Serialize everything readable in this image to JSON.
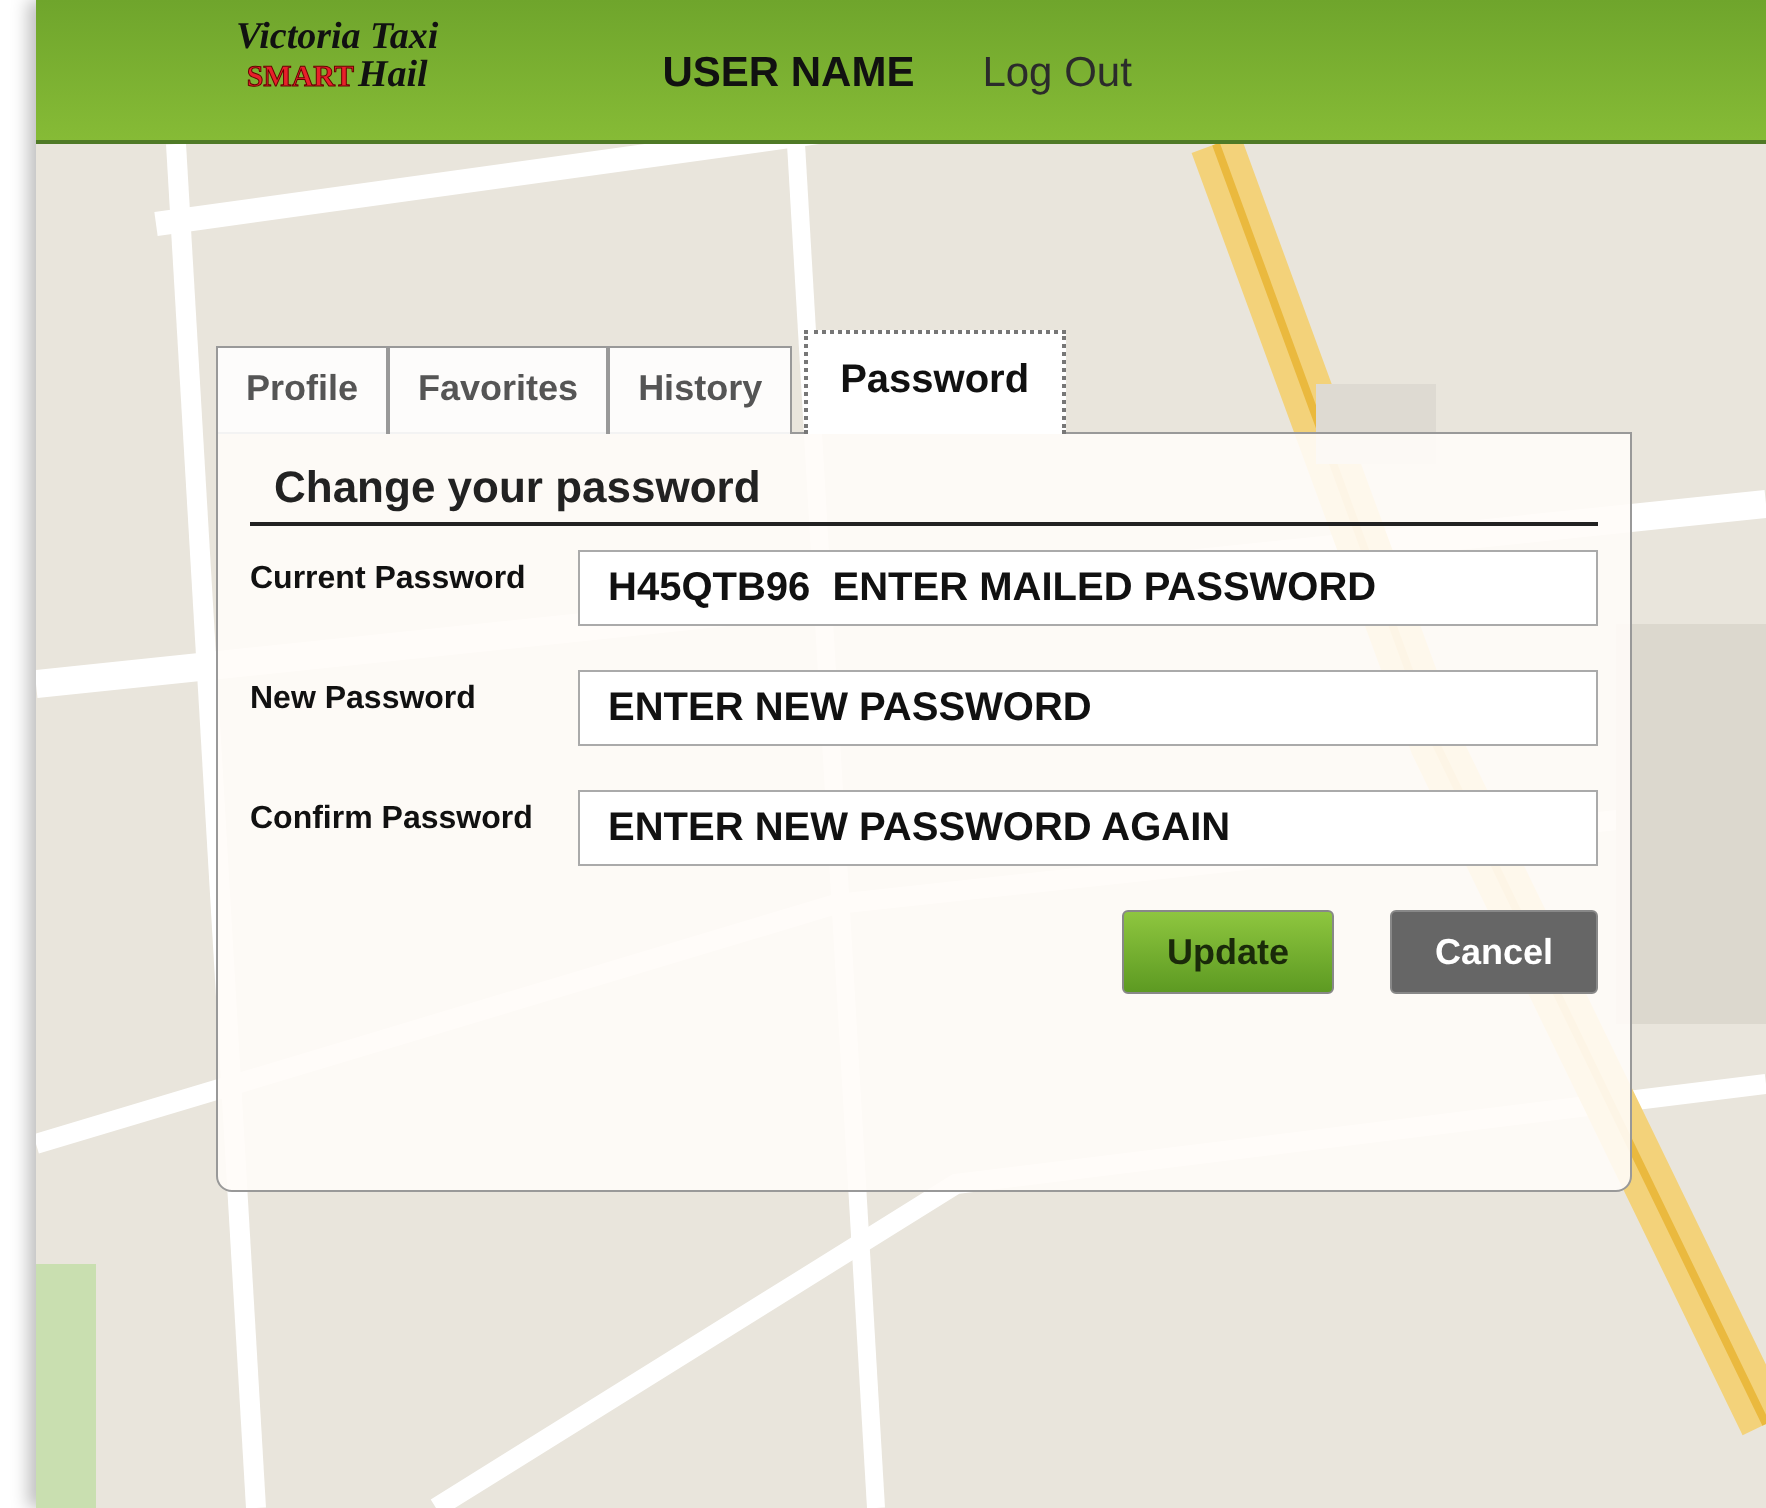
{
  "header": {
    "logo": {
      "line_1": "Victoria Taxi",
      "line_2a": "SMART",
      "line_2b": "Hail"
    },
    "user_name": "USER NAME",
    "logout": "Log Out"
  },
  "tabs": [
    {
      "label": "Profile",
      "selected": false
    },
    {
      "label": "Favorites",
      "selected": false
    },
    {
      "label": "History",
      "selected": false
    },
    {
      "label": "Password",
      "selected": true
    }
  ],
  "panel": {
    "title": "Change your password",
    "fields": [
      {
        "label": "Current Password",
        "value": "H45QTB96  ENTER MAILED PASSWORD"
      },
      {
        "label": "New Password",
        "value": "ENTER NEW PASSWORD"
      },
      {
        "label": "Confirm Password",
        "value": "ENTER NEW PASSWORD AGAIN"
      }
    ],
    "buttons": [
      {
        "kind": "primary",
        "label": "Update"
      },
      {
        "kind": "secondary",
        "label": "Cancel"
      }
    ]
  }
}
